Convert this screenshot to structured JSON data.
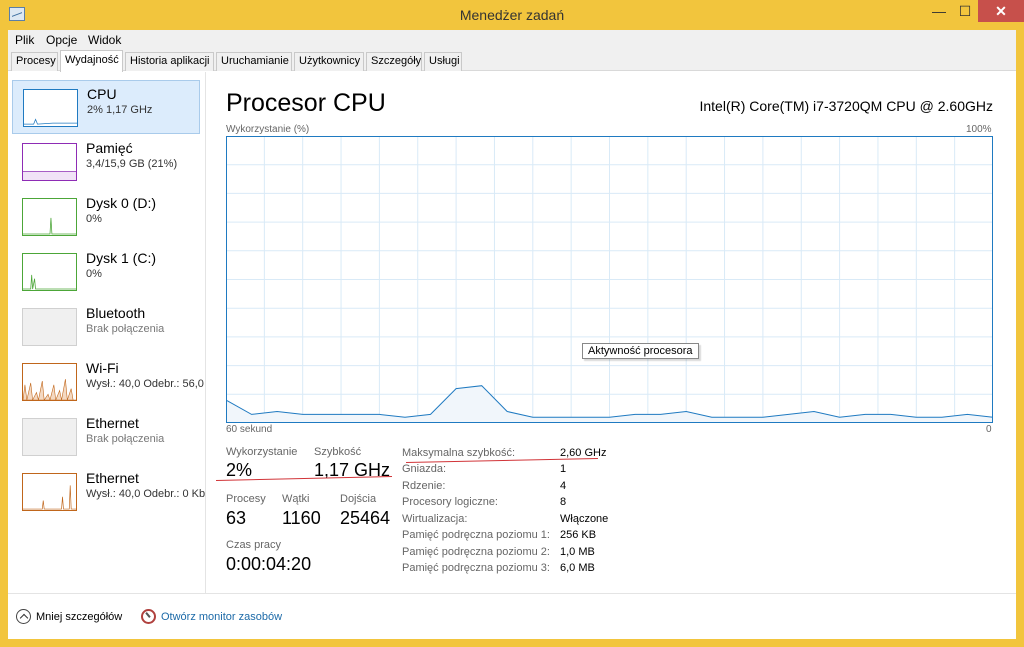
{
  "window": {
    "title": "Menedżer zadań",
    "minimize": "—",
    "maximize": "☐",
    "close": "✕"
  },
  "menu": [
    "Plik",
    "Opcje",
    "Widok"
  ],
  "tabs": [
    "Procesy",
    "Wydajność",
    "Historia aplikacji",
    "Uruchamianie",
    "Użytkownicy",
    "Szczegóły",
    "Usługi"
  ],
  "active_tab": "Wydajność",
  "sidebar": {
    "items": [
      {
        "name": "CPU",
        "sub": "2% 1,17 GHz",
        "color": "#1f7ac1"
      },
      {
        "name": "Pamięć",
        "sub": "3,4/15,9 GB (21%)",
        "color": "#8e2cb5"
      },
      {
        "name": "Dysk 0 (D:)",
        "sub": "0%",
        "color": "#4ca638"
      },
      {
        "name": "Dysk 1 (C:)",
        "sub": "0%",
        "color": "#4ca638"
      },
      {
        "name": "Bluetooth",
        "sub": "Brak połączenia",
        "color": "#aaaaaa"
      },
      {
        "name": "Wi-Fi",
        "sub": "Wysł.: 40,0 Odebr.: 56,0",
        "color": "#c0661b"
      },
      {
        "name": "Ethernet",
        "sub": "Brak połączenia",
        "color": "#aaaaaa"
      },
      {
        "name": "Ethernet",
        "sub": "Wysł.: 40,0 Odebr.: 0 Kb",
        "color": "#c0661b"
      }
    ]
  },
  "main": {
    "title": "Procesor CPU",
    "cpu_model": "Intel(R) Core(TM) i7-3720QM CPU @ 2.60GHz",
    "util_label": "Wykorzystanie (%)",
    "max_label": "100%",
    "seconds_label": "60 sekund",
    "zero_label": "0",
    "tooltip": "Aktywność procesora",
    "stats": {
      "util_label": "Wykorzystanie",
      "util_value": "2%",
      "speed_label": "Szybkość",
      "speed_value": "1,17 GHz",
      "proc_label": "Procesy",
      "proc_value": "63",
      "threads_label": "Wątki",
      "threads_value": "1160",
      "handles_label": "Dojścia",
      "handles_value": "25464",
      "uptime_label": "Czas pracy",
      "uptime_value": "0:00:04:20"
    },
    "info": [
      {
        "label": "Maksymalna szybkość:",
        "value": "2,60 GHz"
      },
      {
        "label": "Gniazda:",
        "value": "1"
      },
      {
        "label": "Rdzenie:",
        "value": "4"
      },
      {
        "label": "Procesory logiczne:",
        "value": "8"
      },
      {
        "label": "Wirtualizacja:",
        "value": "Włączone"
      },
      {
        "label": "Pamięć podręczna poziomu 1:",
        "value": "256 KB"
      },
      {
        "label": "Pamięć podręczna poziomu 2:",
        "value": "1,0 MB"
      },
      {
        "label": "Pamięć podręczna poziomu 3:",
        "value": "6,0 MB"
      }
    ]
  },
  "footer": {
    "fewer_details": "Mniej szczegółów",
    "open_monitor": "Otwórz monitor zasobów"
  },
  "colors": {
    "title_bar": "#f2c53d",
    "close_button": "#c7504b",
    "cpu_graph": "#1f7ac1",
    "grid": "#d9eaf7",
    "link": "#1c6aa8",
    "underline": "#d13438"
  },
  "chart_data": {
    "type": "area",
    "title": "Wykorzystanie (%)",
    "xlabel": "60 sekund",
    "x": [
      60,
      58,
      56,
      54,
      52,
      50,
      48,
      46,
      44,
      42,
      40,
      38,
      36,
      34,
      32,
      30,
      28,
      26,
      24,
      22,
      20,
      18,
      16,
      14,
      12,
      10,
      8,
      6,
      4,
      2,
      0
    ],
    "series": [
      {
        "name": "",
        "values": [
          8,
          3,
          4,
          3,
          3,
          3,
          3,
          2,
          3,
          12,
          13,
          4,
          2,
          2,
          2,
          2,
          3,
          3,
          4,
          2,
          2,
          2,
          3,
          4,
          2,
          3,
          3,
          2,
          2,
          3,
          2
        ]
      }
    ],
    "ylim": [
      0,
      100
    ],
    "xlim": [
      60,
      0
    ],
    "grid": true
  }
}
